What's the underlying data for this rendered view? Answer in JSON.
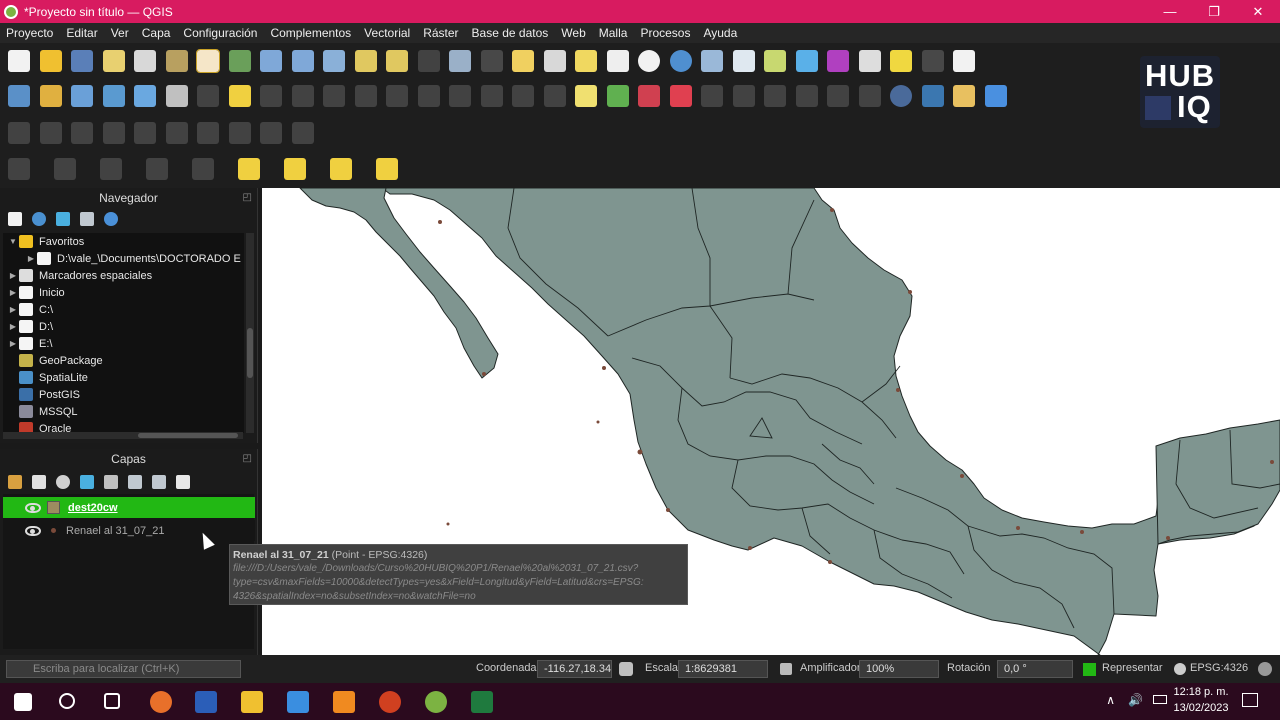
{
  "window": {
    "title": "*Proyecto sin título — QGIS",
    "minimize": "—",
    "maximize": "❐",
    "close": "✕"
  },
  "menu": [
    "Proyecto",
    "Editar",
    "Ver",
    "Capa",
    "Configuración",
    "Complementos",
    "Vectorial",
    "Ráster",
    "Base de datos",
    "Web",
    "Malla",
    "Procesos",
    "Ayuda"
  ],
  "logo": {
    "line1": "HUB",
    "line2": "IQ"
  },
  "navigator": {
    "title": "Navegador",
    "items": [
      {
        "label": "Favoritos",
        "icon": "star-icon",
        "level": 0,
        "arrow": "▼",
        "color": "#f0c020"
      },
      {
        "label": "D:\\vale_\\Documents\\DOCTORADO E",
        "icon": "folder-icon",
        "level": 1,
        "arrow": "▶",
        "color": "#f5f5f5"
      },
      {
        "label": "Marcadores espaciales",
        "icon": "bookmark-icon",
        "level": 0,
        "arrow": "▶",
        "color": "#dddddd"
      },
      {
        "label": "Inicio",
        "icon": "home-folder-icon",
        "level": 0,
        "arrow": "▶",
        "color": "#f5f5f5"
      },
      {
        "label": "C:\\",
        "icon": "drive-folder-icon",
        "level": 0,
        "arrow": "▶",
        "color": "#f5f5f5"
      },
      {
        "label": "D:\\",
        "icon": "drive-folder-icon",
        "level": 0,
        "arrow": "▶",
        "color": "#f5f5f5"
      },
      {
        "label": "E:\\",
        "icon": "drive-folder-icon",
        "level": 0,
        "arrow": "▶",
        "color": "#f5f5f5"
      },
      {
        "label": "GeoPackage",
        "icon": "geopackage-icon",
        "level": 0,
        "arrow": "",
        "color": "#c5b34a"
      },
      {
        "label": "SpatiaLite",
        "icon": "spatialite-icon",
        "level": 0,
        "arrow": "",
        "color": "#4a90c8"
      },
      {
        "label": "PostGIS",
        "icon": "postgis-icon",
        "level": 0,
        "arrow": "",
        "color": "#3a6fa8"
      },
      {
        "label": "MSSQL",
        "icon": "mssql-icon",
        "level": 0,
        "arrow": "",
        "color": "#8a8a9a"
      },
      {
        "label": "Oracle",
        "icon": "oracle-icon",
        "level": 0,
        "arrow": "",
        "color": "#c03a2a"
      }
    ]
  },
  "layers": {
    "title": "Capas",
    "items": [
      {
        "name": "dest20cw",
        "selected": true
      },
      {
        "name": "Renael al 31_07_21",
        "selected": false
      }
    ]
  },
  "tooltip": {
    "title": "Renael al 31_07_21",
    "subtitle": "(Point - EPSG:4326)",
    "lines": [
      "file:///D:/Users/vale_/Downloads/Curso%20HUBIQ%20P1/Renael%20al%2031_07_21.csv?",
      "type=csv&maxFields=10000&detectTypes=yes&xField=Longitud&yField=Latitud&crs=EPSG:",
      "4326&spatialIndex=no&subsetIndex=no&watchFile=no"
    ]
  },
  "status": {
    "locator_placeholder": "Escriba para localizar (Ctrl+K)",
    "coord_label": "Coordenada",
    "coord_value": "-116.27,18.34",
    "scale_label": "Escala",
    "scale_value": "1:8629381",
    "magnifier_label": "Amplificador",
    "magnifier_value": "100%",
    "rotation_label": "Rotación",
    "rotation_value": "0,0 °",
    "render_label": "Representar",
    "crs": "EPSG:4326"
  },
  "taskbar": {
    "time": "12:18 p. m.",
    "date": "13/02/2023"
  },
  "colors": {
    "title_bar": "#d81b60",
    "layer_selected": "#22b814",
    "map_fill": "#7f9590",
    "map_border": "#1f2624"
  }
}
